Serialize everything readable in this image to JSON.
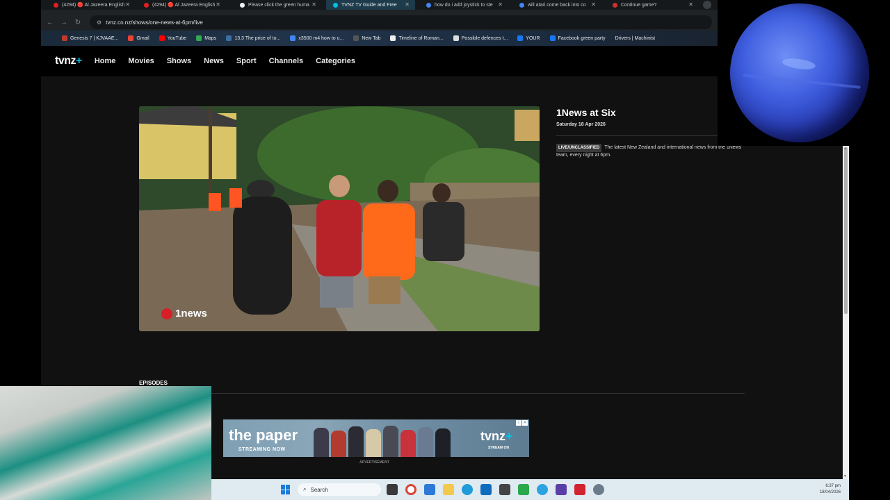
{
  "browser": {
    "tabs": [
      {
        "label": "(4294) 🔴 Al Jazeera English",
        "fav": "#e02020"
      },
      {
        "label": "(4294) 🔴 Al Jazeera English",
        "fav": "#e02020"
      },
      {
        "label": "Please click the green huma",
        "fav": "#f0f0f0"
      },
      {
        "label": "TVNZ TV Guide and Free",
        "fav": "#00c2e8"
      },
      {
        "label": "how do i add joystick to ste",
        "fav": "#4285f4"
      },
      {
        "label": "will atari come back into co",
        "fav": "#4285f4"
      },
      {
        "label": "Continue game?",
        "fav": "#d03030"
      }
    ],
    "url": "tvnz.co.nz/shows/one-news-at-6pm/live",
    "bookmarks": [
      {
        "label": "Genesis 7 | KJVAAE...",
        "fav": "#c0392b"
      },
      {
        "label": "Gmail",
        "fav": "#ea4335"
      },
      {
        "label": "YouTube",
        "fav": "#ff0000"
      },
      {
        "label": "Maps",
        "fav": "#34a853"
      },
      {
        "label": "13.3 The price of to...",
        "fav": "#3a6ea5"
      },
      {
        "label": "x3500 m4 how to u...",
        "fav": "#4285f4"
      },
      {
        "label": "New Tab",
        "fav": "#555"
      },
      {
        "label": "Timeline of Roman...",
        "fav": "#eee"
      },
      {
        "label": "Possible defences t...",
        "fav": "#ddd"
      },
      {
        "label": "YOUR",
        "fav": "#1877f2"
      },
      {
        "label": "Facebook green party",
        "fav": "#1877f2"
      },
      {
        "label": "Drivers | Machinist",
        "fav": "#888"
      }
    ]
  },
  "site": {
    "logo": "tvnz",
    "logo_plus": "+",
    "nav": [
      "Home",
      "Movies",
      "Shows",
      "News",
      "Sport",
      "Channels",
      "Categories"
    ],
    "player_watermark": "1news",
    "show_title": "1News at Six",
    "show_date": "Saturday 18 Apr 2026",
    "badge": "LIVE/UNCLASSIFIED",
    "description": "The latest New Zealand and international news from the 1News team, every night at 6pm.",
    "episodes_label": "EPISODES",
    "ad": {
      "title": "the paper",
      "subtitle": "STREAMING NOW",
      "brand": "tvnz",
      "brand_plus": "+",
      "brand_sub": "STREAM ON",
      "label": "ADVERTISEMENT"
    }
  },
  "taskbar": {
    "search_placeholder": "Search",
    "time": "6:37 pm",
    "date": "18/04/2026"
  }
}
